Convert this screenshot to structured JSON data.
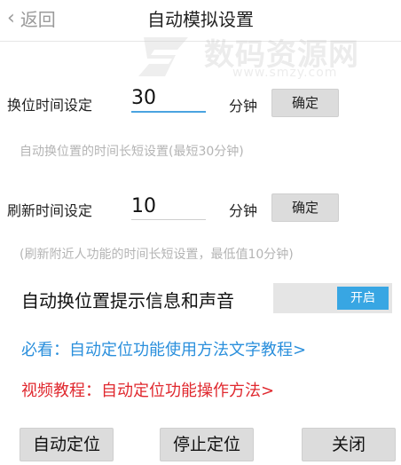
{
  "header": {
    "back_label": "返回",
    "title": "自动模拟设置"
  },
  "watermark": {
    "cn": "数码资源网",
    "url": "www.smzy.com"
  },
  "switch_interval": {
    "label": "换位时间设定",
    "value": "30",
    "unit": "分钟",
    "confirm": "确定",
    "hint": "自动换位置的时间长短设置(最短30分钟)"
  },
  "refresh_interval": {
    "label": "刷新时间设定",
    "value": "10",
    "unit": "分钟",
    "confirm": "确定",
    "hint": "(刷新附近人功能的时间长短设置，最低值10分钟)"
  },
  "notify_toggle": {
    "label": "自动换位置提示信息和声音",
    "state": "开启"
  },
  "links": {
    "text_tutorial": "必看：自动定位功能使用方法文字教程>",
    "video_tutorial": "视频教程：自动定位功能操作方法>"
  },
  "actions": {
    "auto_locate": "自动定位",
    "stop_locate": "停止定位",
    "close": "关闭"
  },
  "colors": {
    "accent": "#38a6e3",
    "link_blue": "#2a8fdc",
    "link_red": "#e0282e"
  }
}
